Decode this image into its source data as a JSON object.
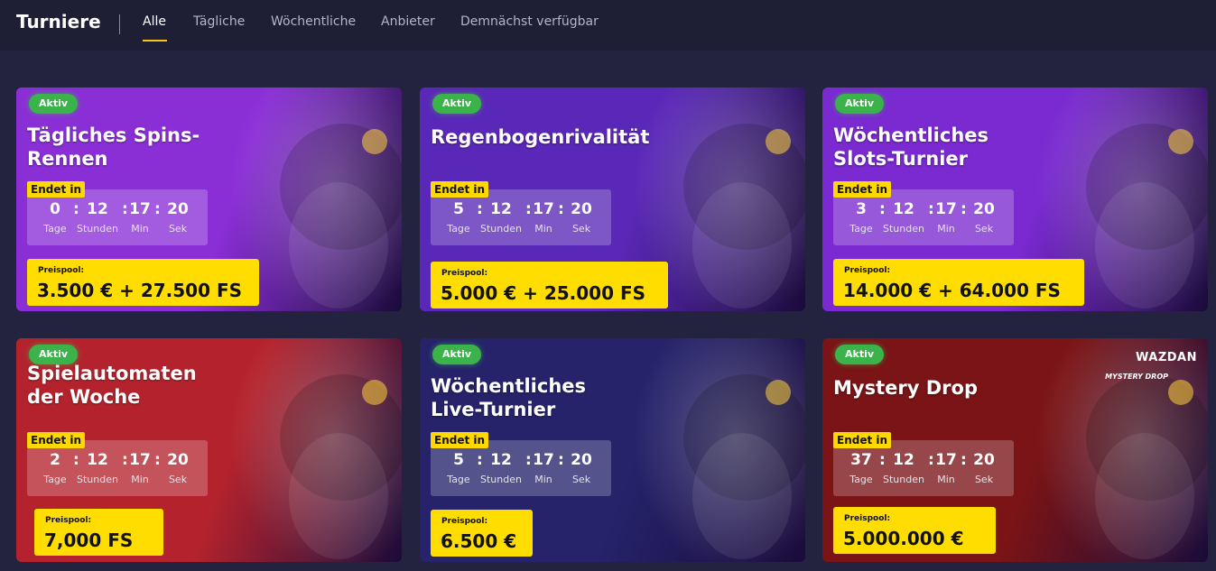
{
  "header": {
    "title": "Turniere",
    "tabs": [
      {
        "label": "Alle",
        "active": true
      },
      {
        "label": "Tägliche",
        "active": false
      },
      {
        "label": "Wöchentliche",
        "active": false
      },
      {
        "label": "Anbieter",
        "active": false
      },
      {
        "label": "Demnächst verfügbar",
        "active": false
      }
    ]
  },
  "labels": {
    "ends": "Endet in",
    "days": "Tage",
    "hours": "Stunden",
    "minutes": "Min",
    "seconds": "Sek",
    "prize_pool": "Preispool:",
    "sep": ":"
  },
  "cards": [
    {
      "status": "Aktiv",
      "title": "Tägliches Spins-\nRennen",
      "days": "0",
      "hours": "12",
      "minutes": "17",
      "seconds": "20",
      "prize": "3.500 € + 27.500 FS",
      "bg": "#8a2fd6"
    },
    {
      "status": "Aktiv",
      "title": "Regenbogenrivalität",
      "days": "5",
      "hours": "12",
      "minutes": "17",
      "seconds": "20",
      "prize": "5.000 € + 25.000 FS",
      "bg": "#5a28b8"
    },
    {
      "status": "Aktiv",
      "title": "Wöchentliches\nSlots-Turnier",
      "days": "3",
      "hours": "12",
      "minutes": "17",
      "seconds": "20",
      "prize": "14.000 € + 64.000 FS",
      "bg": "#7a2ad0"
    },
    {
      "status": "Aktiv",
      "title": "Spielautomaten\nder Woche",
      "days": "2",
      "hours": "12",
      "minutes": "17",
      "seconds": "20",
      "prize": "7,000 FS",
      "bg": "#b4232d"
    },
    {
      "status": "Aktiv",
      "title": "Wöchentliches\nLive-Turnier",
      "days": "5",
      "hours": "12",
      "minutes": "17",
      "seconds": "20",
      "prize": "6.500 €",
      "bg": "#26236b"
    },
    {
      "status": "Aktiv",
      "title": "Mystery Drop",
      "days": "37",
      "hours": "12",
      "minutes": "17",
      "seconds": "20",
      "prize": "5.000.000 €",
      "bg": "#7a1416",
      "provider": "WAZDAN",
      "provider_sub": "MYSTERY DROP"
    }
  ]
}
